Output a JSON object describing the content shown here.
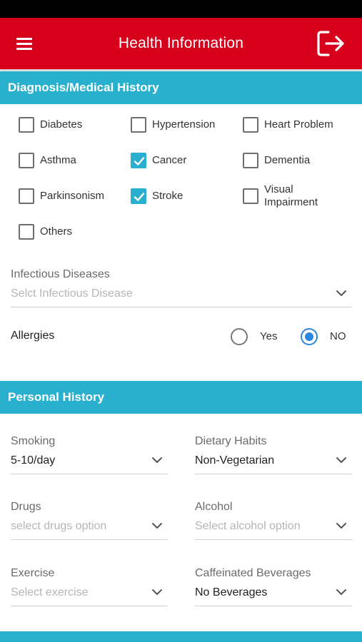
{
  "app_bar": {
    "title": "Health Information",
    "menu_icon": "hamburger-menu-icon",
    "logout_icon": "logout-icon",
    "color": "#d6001c"
  },
  "diagnosis": {
    "header": "Diagnosis/Medical History",
    "conditions": [
      {
        "label": "Diabetes",
        "checked": false
      },
      {
        "label": "Hypertension",
        "checked": false
      },
      {
        "label": "Heart Problem",
        "checked": false
      },
      {
        "label": "Asthma",
        "checked": false
      },
      {
        "label": "Cancer",
        "checked": true
      },
      {
        "label": "Dementia",
        "checked": false
      },
      {
        "label": "Parkinsonism",
        "checked": false
      },
      {
        "label": "Stroke",
        "checked": true
      },
      {
        "label": "Visual Impairment",
        "checked": false
      },
      {
        "label": "Others",
        "checked": false
      }
    ],
    "infectious": {
      "label": "Infectious Diseases",
      "placeholder": "Selct Infectious Disease"
    },
    "allergies": {
      "label": "Allergies",
      "options": [
        "Yes",
        "NO"
      ],
      "selected": "NO"
    }
  },
  "personal": {
    "header": "Personal History",
    "smoking": {
      "label": "Smoking",
      "value": "5-10/day"
    },
    "dietary": {
      "label": "Dietary Habits",
      "value": "Non-Vegetarian"
    },
    "drugs": {
      "label": "Drugs",
      "placeholder": "select drugs option"
    },
    "alcohol": {
      "label": "Alcohol",
      "placeholder": "Select alcohol option"
    },
    "exercise": {
      "label": "Exercise",
      "placeholder": "Select exercise"
    },
    "caffeine": {
      "label": "Caffeinated Beverages",
      "value": "No Beverages"
    }
  },
  "colors": {
    "accent": "#2ab0cf",
    "radio_selected": "#2a86e0"
  }
}
